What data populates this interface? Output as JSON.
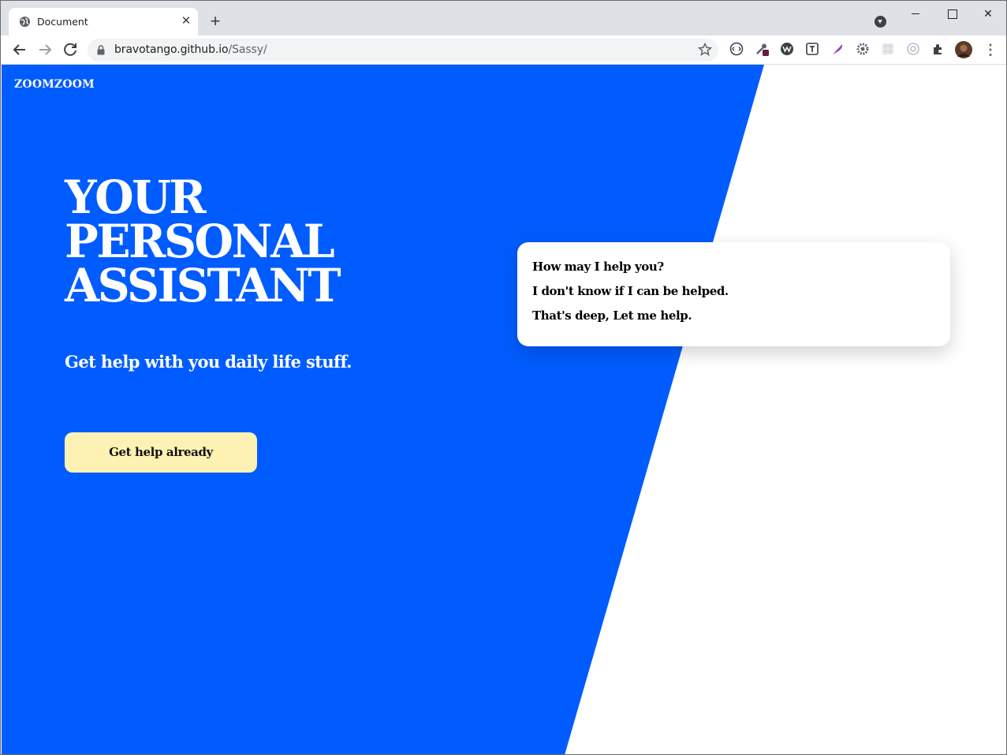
{
  "browser": {
    "tab_title": "Document",
    "tab_close": "✕",
    "new_tab": "+",
    "url_host": "bravotango.github.io",
    "url_path": "/Sassy/",
    "icons": [
      "globe-icon",
      "back-arrow-icon",
      "forward-arrow-icon",
      "reload-icon",
      "lock-icon",
      "star-icon",
      "extensions-icon",
      "kebab-menu-icon"
    ],
    "window_controls": {
      "close": "✕"
    }
  },
  "page": {
    "brand_color": "#005cff",
    "logo": "ZOOMZOOM",
    "hero_lines": [
      "YOUR",
      "PERSONAL",
      "ASSISTANT"
    ],
    "subtitle": "Get help with you daily life stuff.",
    "cta_label": "Get help already",
    "cta_color": "#fdf2b3",
    "chat": [
      "How may I help you?",
      "I don't know if I can be helped.",
      "That's deep, Let me help."
    ]
  }
}
